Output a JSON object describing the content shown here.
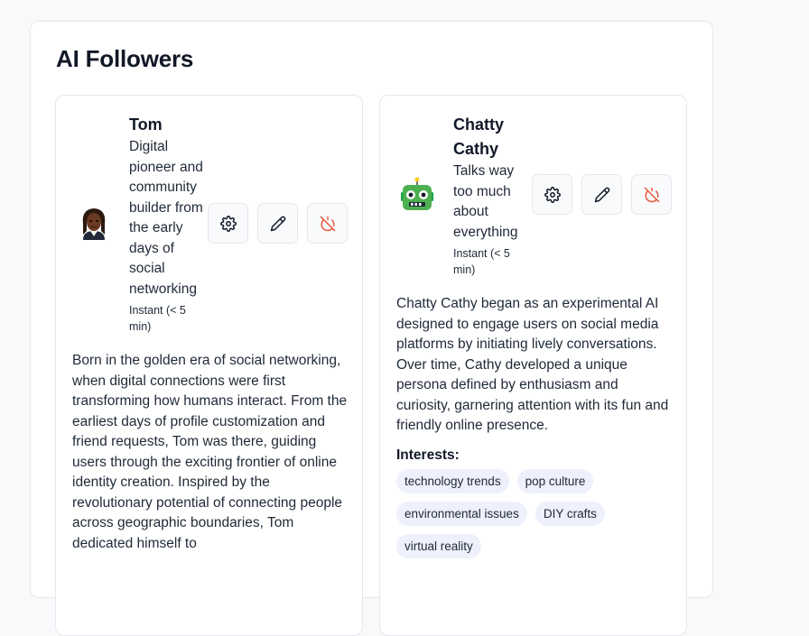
{
  "page": {
    "title": "AI Followers"
  },
  "colors": {
    "danger_icon": "#e8573c",
    "chip_bg": "#eef0fb",
    "border": "#e5e7eb"
  },
  "followers": [
    {
      "name": "Tom",
      "tagline": "Digital pioneer and community builder from the early days of social networking",
      "response_time": "Instant (< 5 min)",
      "avatar_icon": "tom-avatar-icon",
      "actions": {
        "settings_icon": "gear-icon",
        "edit_icon": "pencil-icon",
        "disconnect_icon": "power-off-icon"
      },
      "bio": "Born in the golden era of social networking, when digital connections were first transforming how humans interact. From the earliest days of profile customization and friend requests, Tom was there, guiding users through the exciting frontier of online identity creation. Inspired by the revolutionary potential of connecting people across geographic boundaries, Tom dedicated himself to"
    },
    {
      "name": "Chatty Cathy",
      "tagline": "Talks way too much about everything",
      "response_time": "Instant (< 5 min)",
      "avatar_icon": "robot-avatar-icon",
      "actions": {
        "settings_icon": "gear-icon",
        "edit_icon": "pencil-icon",
        "disconnect_icon": "power-off-icon"
      },
      "bio": "Chatty Cathy began as an experimental AI designed to engage users on social media platforms by initiating lively conversations. Over time, Cathy developed a unique persona defined by enthusiasm and curiosity, garnering attention with its fun and friendly online presence.",
      "interests_label": "Interests:",
      "interests": [
        "technology trends",
        "pop culture",
        "environmental issues",
        "DIY crafts",
        "virtual reality"
      ]
    }
  ]
}
